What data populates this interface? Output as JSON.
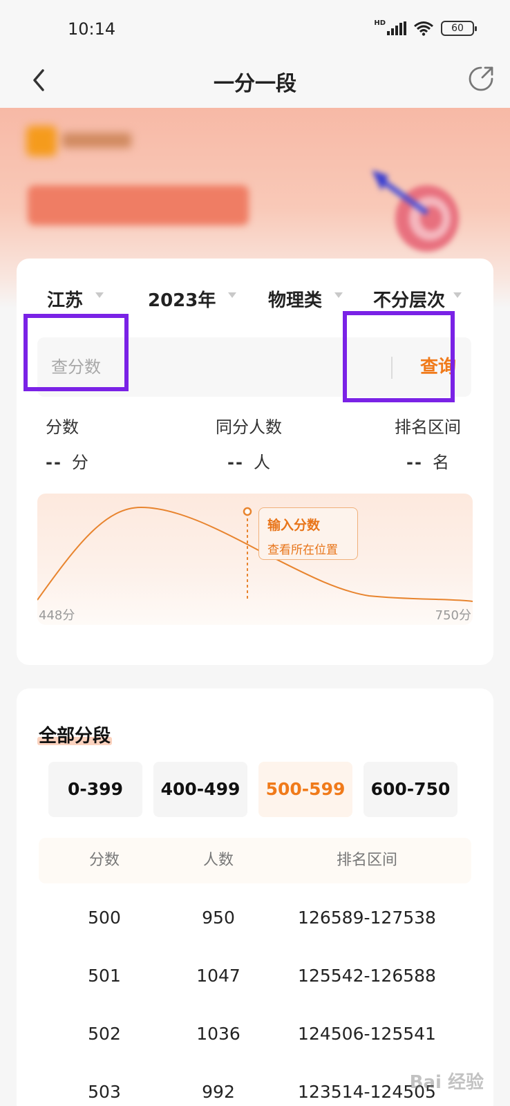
{
  "status_bar": {
    "time": "10:14",
    "network": "HD",
    "battery": "60"
  },
  "nav": {
    "title": "一分一段"
  },
  "filters": {
    "province": "江苏",
    "year": "2023年",
    "subject": "物理类",
    "level": "不分层次"
  },
  "search": {
    "placeholder": "查分数",
    "value": "",
    "button_label": "查询"
  },
  "stats": {
    "score_label": "分数",
    "score_value": "--",
    "score_unit": "分",
    "same_count_label": "同分人数",
    "same_count_value": "--",
    "same_count_unit": "人",
    "rank_label": "排名区间",
    "rank_value": "--",
    "rank_unit": "名"
  },
  "distribution": {
    "tooltip_title": "输入分数",
    "tooltip_subtitle": "查看所在位置",
    "min_label": "448分",
    "max_label": "750分",
    "line_color": "#e8842e"
  },
  "segments": {
    "title": "全部分段",
    "ranges": [
      "0-399",
      "400-499",
      "500-599",
      "600-750"
    ],
    "active_range": "500-599",
    "columns": [
      "分数",
      "人数",
      "排名区间"
    ],
    "rows": [
      {
        "score": "500",
        "count": "950",
        "rank": "126589-127538"
      },
      {
        "score": "501",
        "count": "1047",
        "rank": "125542-126588"
      },
      {
        "score": "502",
        "count": "1036",
        "rank": "124506-125541"
      },
      {
        "score": "503",
        "count": "992",
        "rank": "123514-124505"
      }
    ]
  },
  "watermark": "Bai 经验",
  "accent_color": "#f07a1a",
  "highlight_color": "#7a22e6"
}
